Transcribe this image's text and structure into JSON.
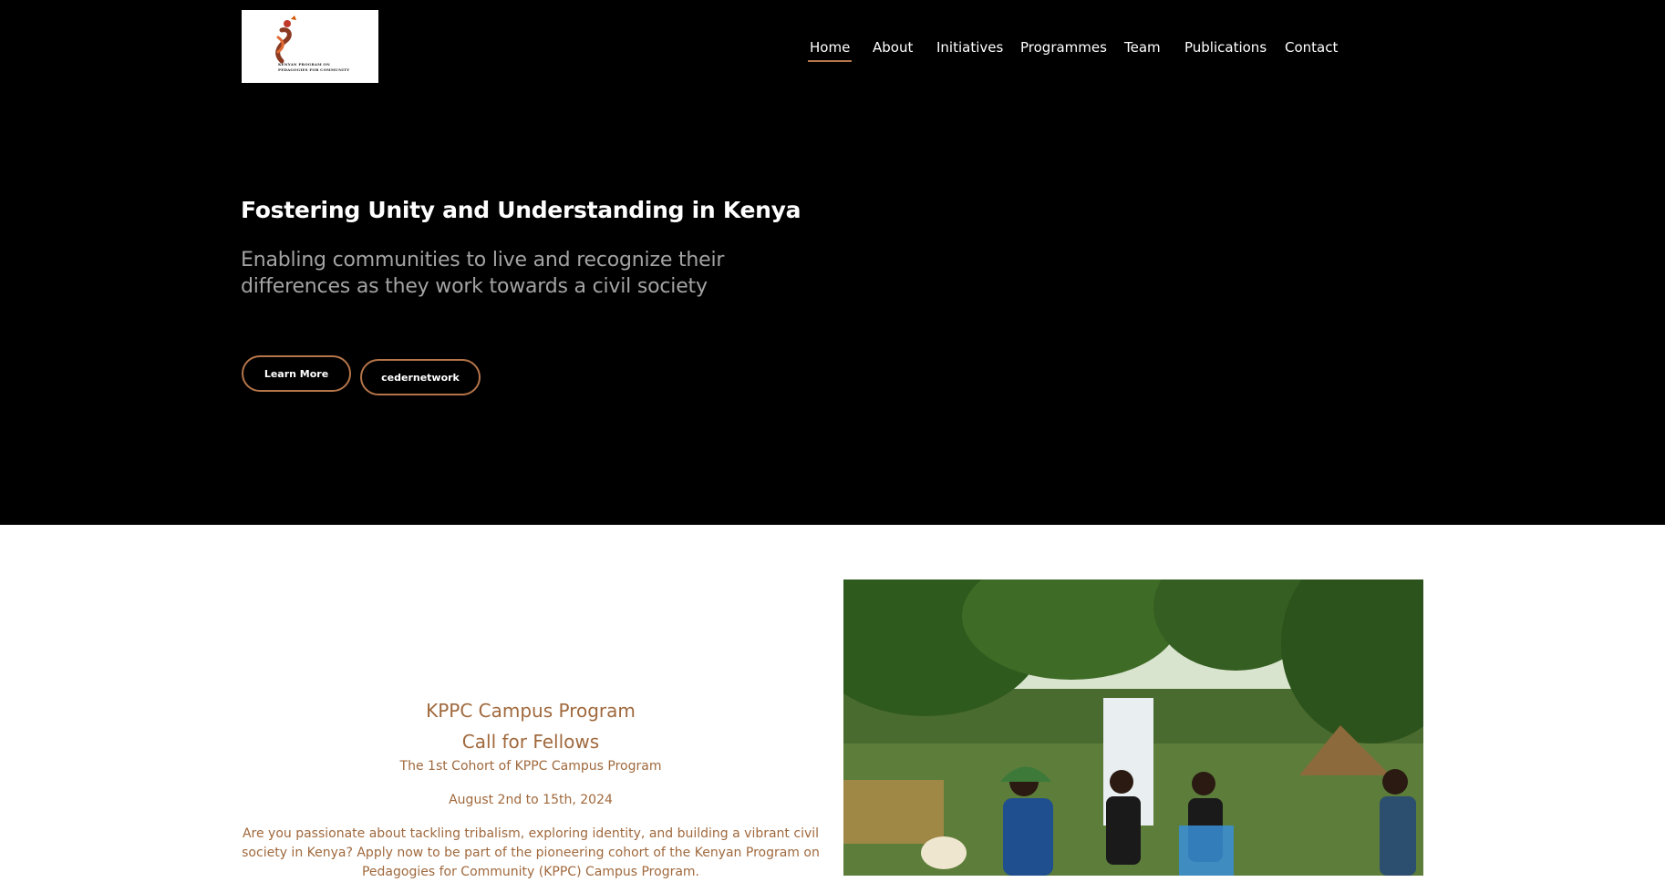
{
  "logo": {
    "line1": "KENYAN PROGRAM ON",
    "line2": "PEDAGOGIES FOR COMMUNITY"
  },
  "nav": [
    {
      "label": "Home"
    },
    {
      "label": "About"
    },
    {
      "label": "Initiatives"
    },
    {
      "label": "Programmes"
    },
    {
      "label": "Team"
    },
    {
      "label": "Publications"
    },
    {
      "label": "Contact"
    }
  ],
  "hero": {
    "title": "Fostering Unity and Understanding in Kenya",
    "subtitle": "Enabling communities to live and recognize their differences as they work towards a civil society",
    "learn_more": "Learn More",
    "cedernetwork": "cedernetwork"
  },
  "program": {
    "title_line1": "KPPC Campus Program",
    "title_line2": "Call for Fellows",
    "cohort": "The 1st Cohort of KPPC Campus Program",
    "dates": "August 2nd to 15th, 2024",
    "description": "Are you passionate about tackling tribalism, exploring identity, and building a vibrant civil society in Kenya? Apply now to be part of the pioneering cohort of the Kenyan Program on Pedagogies for Community (KPPC) Campus Program."
  },
  "colors": {
    "accent": "#b5754a",
    "program_text": "#a0693d",
    "hero_bg": "#000000"
  }
}
